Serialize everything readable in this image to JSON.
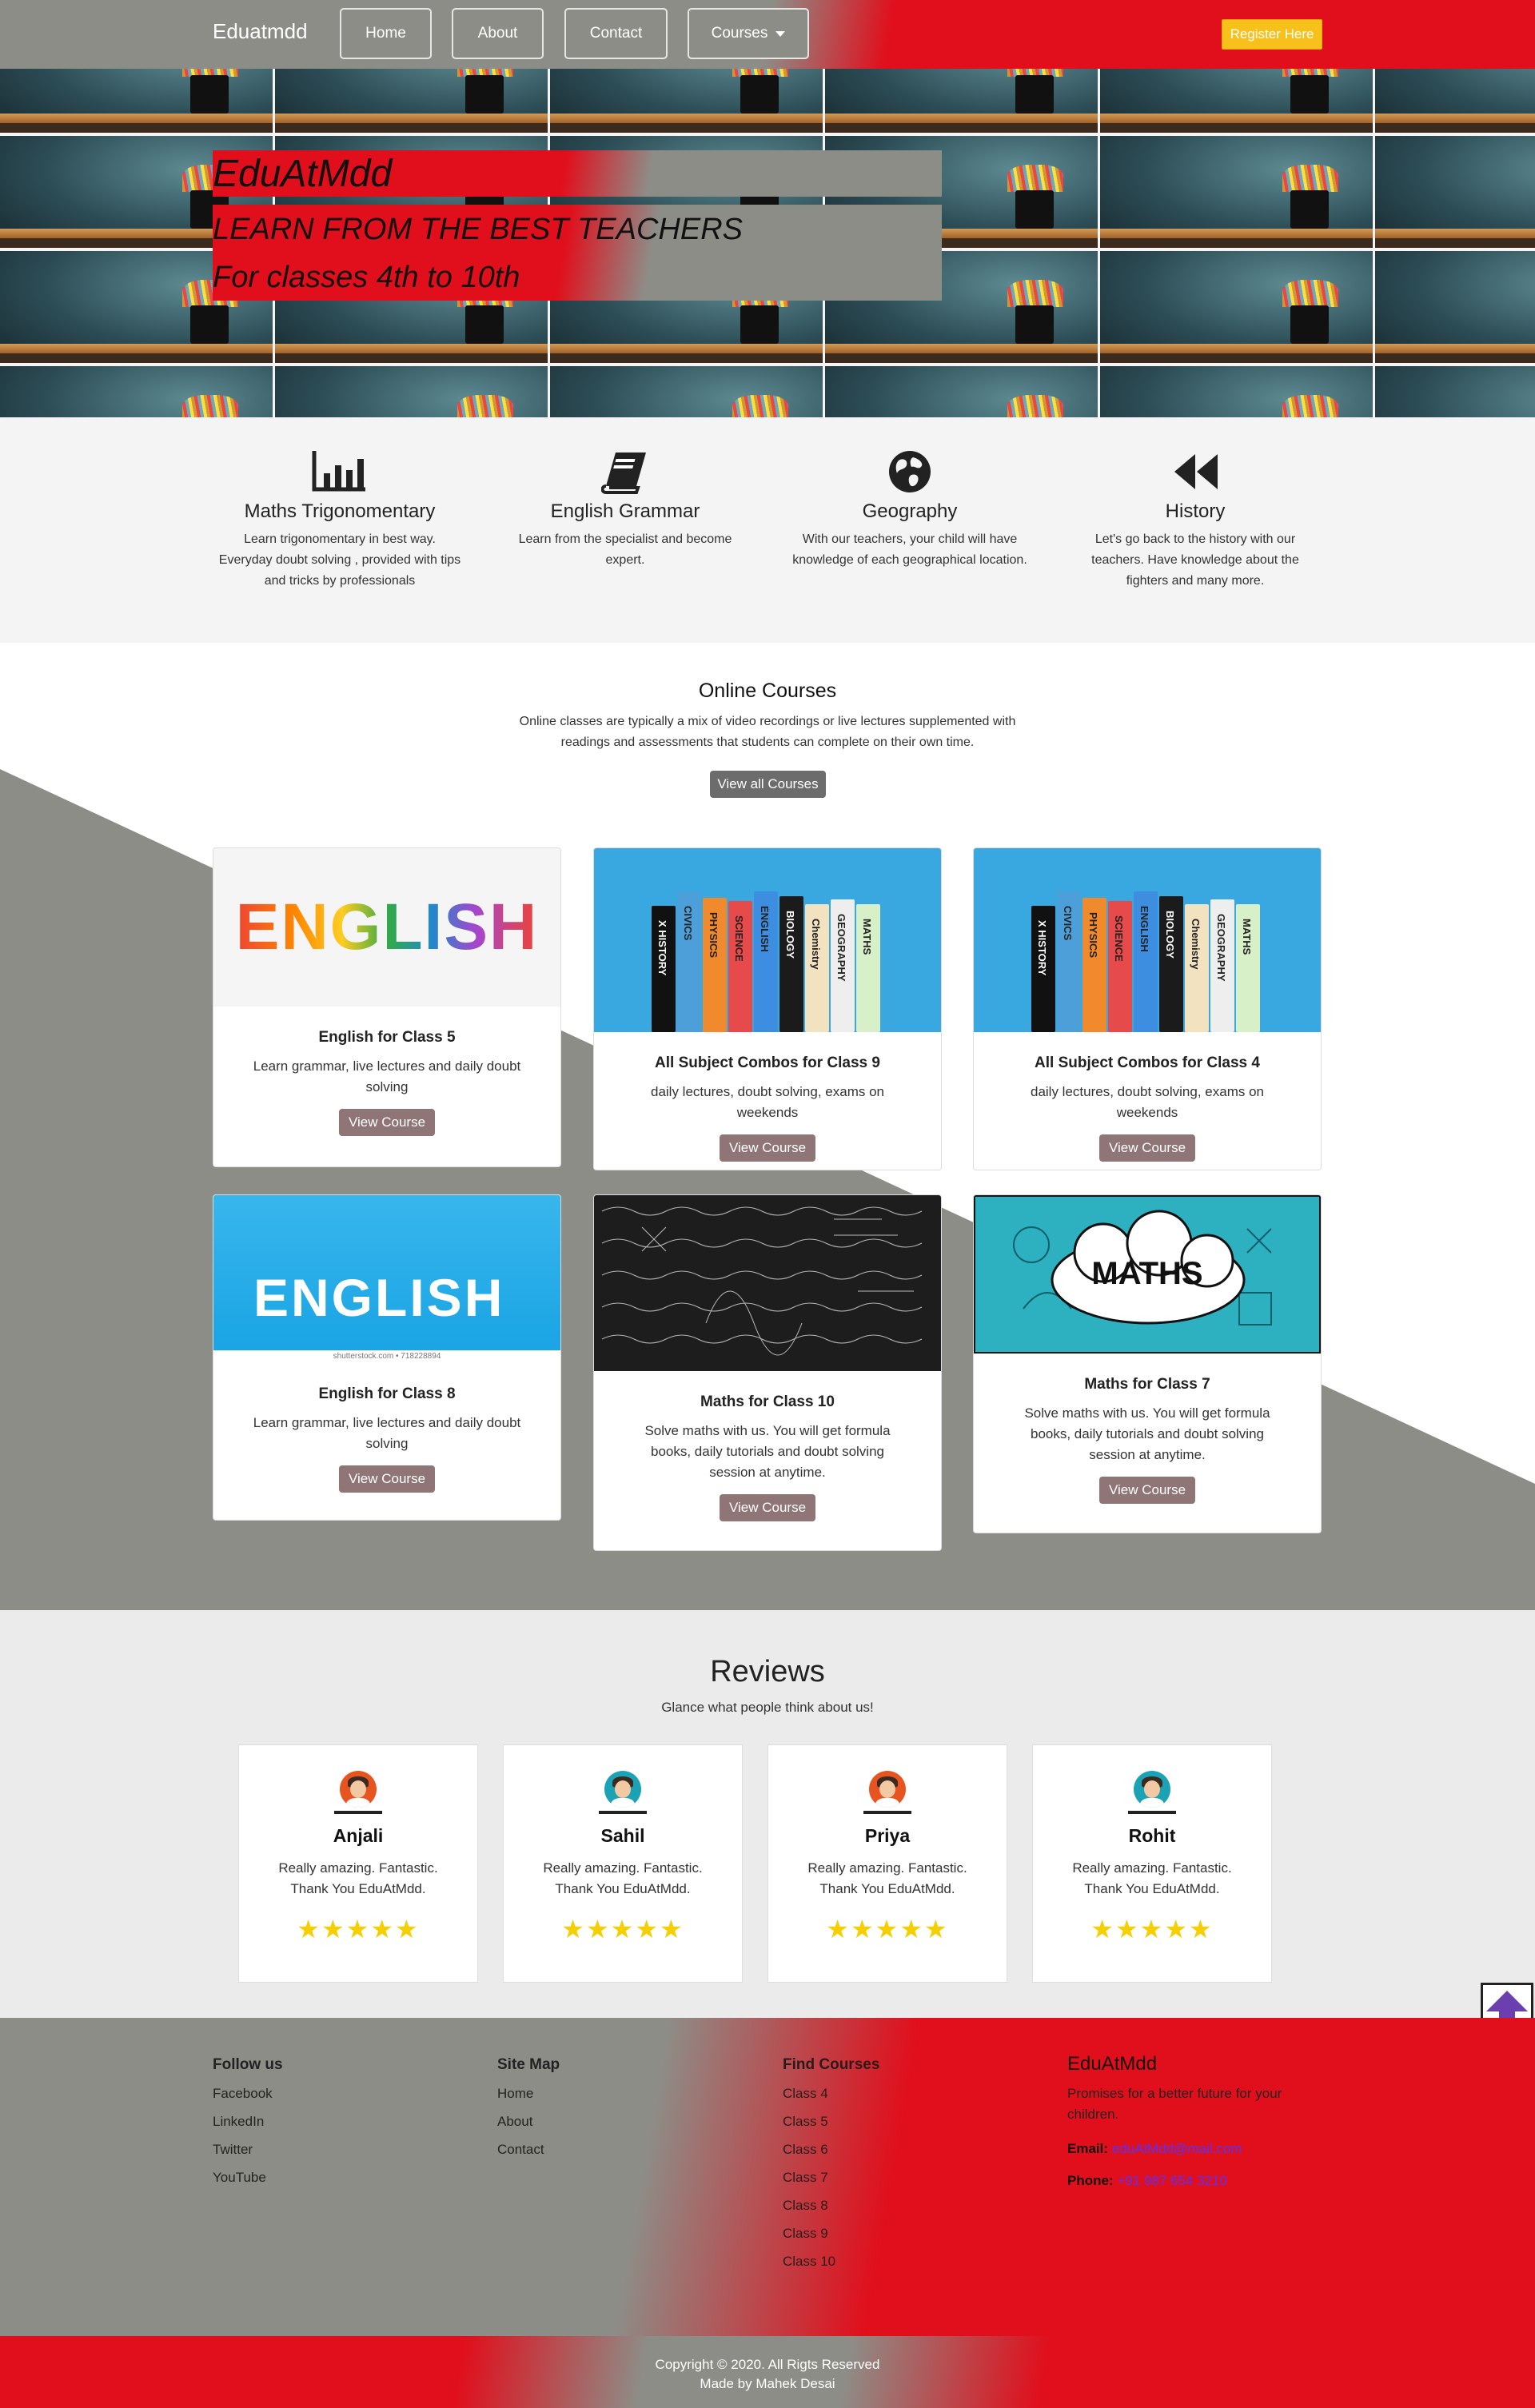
{
  "nav": {
    "brand": "Eduatmdd",
    "links": [
      "Home",
      "About",
      "Contact",
      "Courses"
    ],
    "register": "Register Here"
  },
  "hero": {
    "title": "EduAtMdd",
    "subtitle": "LEARN FROM THE BEST TEACHERS",
    "tagline": "For classes 4th to 10th"
  },
  "features": [
    {
      "icon": "bar-chart-icon",
      "title": "Maths Trigonomentary",
      "text": "Learn trigonomentary in best way. Everyday doubt solving , provided with tips and tricks by professionals"
    },
    {
      "icon": "book-icon",
      "title": "English Grammar",
      "text": "Learn from the specialist and become expert."
    },
    {
      "icon": "globe-icon",
      "title": "Geography",
      "text": "With our teachers, your child will have knowledge of each geographical location."
    },
    {
      "icon": "rewind-icon",
      "title": "History",
      "text": "Let's go back to the history with our teachers. Have knowledge about the fighters and many more."
    }
  ],
  "courses": {
    "title": "Online Courses",
    "description": "Online classes are typically a mix of video recordings or live lectures supplemented with readings and assessments that students can complete on their own time.",
    "view_all": "View all Courses",
    "button_label": "View Course",
    "cards": [
      {
        "title": "English for Class 5",
        "text": "Learn grammar, live lectures and daily doubt solving",
        "image_text": "ENGLISH"
      },
      {
        "title": "All Subject Combos for Class 9",
        "text": "daily lectures, doubt solving, exams on weekends"
      },
      {
        "title": "All Subject Combos for Class 4",
        "text": "daily lectures, doubt solving, exams on weekends"
      },
      {
        "title": "English for Class 8",
        "text": "Learn grammar, live lectures and daily doubt solving",
        "image_text": "ENGLISH",
        "image_caption": "shutterstock.com • 718228894"
      },
      {
        "title": "Maths for Class 10",
        "text": "Solve maths with us. You will get formula books, daily tutorials and doubt solving session at anytime."
      },
      {
        "title": "Maths for Class 7",
        "text": "Solve maths with us. You will get formula books, daily tutorials and doubt solving session at anytime.",
        "image_text": "MATHS"
      }
    ],
    "book_spines": [
      "X HISTORY",
      "CIVICS",
      "PHYSICS",
      "SCIENCE",
      "ENGLISH",
      "BIOLOGY",
      "Chemistry",
      "GEOGRAPHY",
      "MATHS"
    ]
  },
  "reviews": {
    "title": "Reviews",
    "subtitle": "Glance what people think about us!",
    "items": [
      {
        "name": "Anjali",
        "text": "Really amazing. Fantastic. Thank You EduAtMdd.",
        "stars": "★★★★★",
        "avatar_color": "#e8541f"
      },
      {
        "name": "Sahil",
        "text": "Really amazing. Fantastic. Thank You EduAtMdd.",
        "stars": "★★★★★",
        "avatar_color": "#1ba3b5"
      },
      {
        "name": "Priya",
        "text": "Really amazing. Fantastic. Thank You EduAtMdd.",
        "stars": "★★★★★",
        "avatar_color": "#e8541f"
      },
      {
        "name": "Rohit",
        "text": "Really amazing. Fantastic. Thank You EduAtMdd.",
        "stars": "★★★★★",
        "avatar_color": "#1ba3b5"
      }
    ]
  },
  "footer": {
    "follow": {
      "title": "Follow us",
      "links": [
        "Facebook",
        "LinkedIn",
        "Twitter",
        "YouTube"
      ]
    },
    "sitemap": {
      "title": "Site Map",
      "links": [
        "Home",
        "About",
        "Contact"
      ]
    },
    "find": {
      "title": "Find Courses",
      "links": [
        "Class 4",
        "Class 5",
        "Class 6",
        "Class 7",
        "Class 8",
        "Class 9",
        "Class 10"
      ]
    },
    "about": {
      "title": "EduAtMdd",
      "text": "Promises for a better future for your children.",
      "email_label": "Email:",
      "email": "eduAtMdd@mail.com",
      "phone_label": "Phone:",
      "phone": "+91 987 654 3210"
    },
    "copyright": "Copyright © 2020. All Rigts Reserved",
    "made_by": "Made by Mahek Desai"
  },
  "colors": {
    "red": "#e10e1b",
    "grey": "#8d8d87",
    "yellow": "#f7c01a",
    "star": "#f5cf00",
    "link": "#5533ff"
  }
}
